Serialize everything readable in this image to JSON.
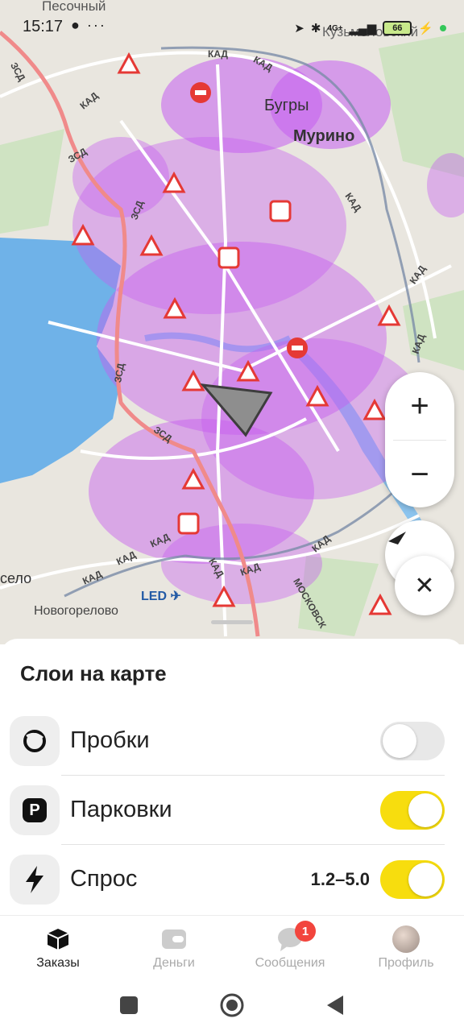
{
  "status_bar": {
    "time": "15:17",
    "left_icons": "● ···",
    "network": "4G+",
    "battery": "66"
  },
  "map": {
    "labels": {
      "pesochny": "Песочный",
      "bugry": "Бугры",
      "murino": "Мурино",
      "kuzmolovsky": "Кузьмоловский",
      "selo": "село",
      "novogorelovo": "Новогорелово",
      "led": "LED ✈"
    },
    "road_labels": {
      "kad": "КАД",
      "zsd": "ЗСД",
      "moskovskoe": "МОСКОВСК"
    },
    "controls": {
      "zoom_in": "+",
      "zoom_out": "−",
      "close": "✕"
    },
    "colors": {
      "water": "#6fb2e8",
      "demand": "#c55cf0",
      "road_red": "#f08a8a",
      "park": "#cfe3c2"
    }
  },
  "layers_sheet": {
    "title": "Слои на карте",
    "layers": [
      {
        "name": "Пробки",
        "value": "",
        "enabled": false,
        "icon": "traffic-icon"
      },
      {
        "name": "Парковки",
        "value": "",
        "enabled": true,
        "icon": "parking-icon"
      },
      {
        "name": "Спрос",
        "value": "1.2–5.0",
        "enabled": true,
        "icon": "lightning-icon"
      }
    ],
    "accent_color": "#f7dd0e"
  },
  "bottom_nav": {
    "items": [
      {
        "label": "Заказы",
        "active": true
      },
      {
        "label": "Деньги",
        "active": false
      },
      {
        "label": "Сообщения",
        "active": false,
        "badge": "1"
      },
      {
        "label": "Профиль",
        "active": false
      }
    ]
  }
}
